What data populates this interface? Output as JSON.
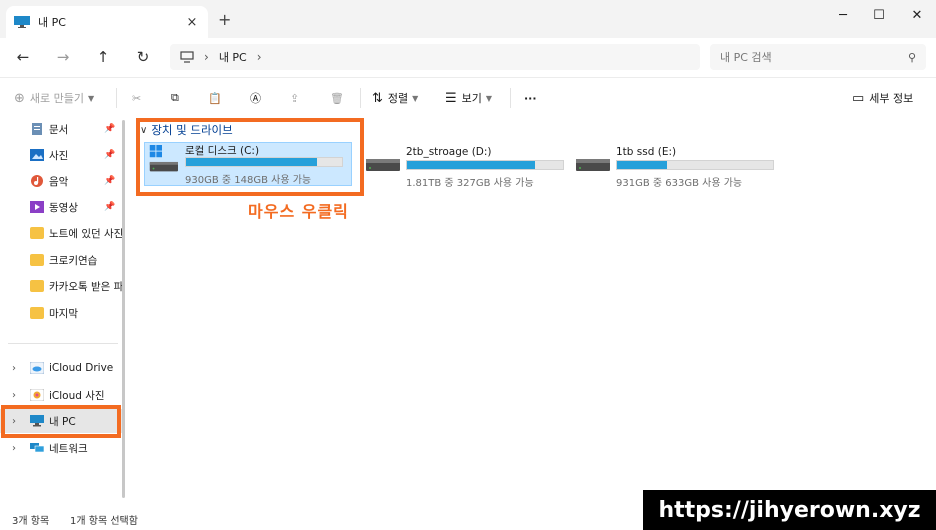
{
  "window": {
    "tab_title": "내 PC",
    "tab_close_icon": "×",
    "new_tab_icon": "+",
    "minimize_icon": "─",
    "maximize_icon": "☐",
    "close_icon": "✕"
  },
  "nav": {
    "back_icon": "←",
    "forward_icon": "→",
    "up_icon": "↑",
    "refresh_icon": "↻",
    "breadcrumb_sep": "›",
    "breadcrumb": [
      "내 PC"
    ],
    "search_placeholder": "내 PC 검색",
    "search_icon": "⚲"
  },
  "toolbar": {
    "new_label": "새로 만들기",
    "new_icon": "⊕",
    "cut_icon": "✂",
    "copy_icon": "⧉",
    "paste_icon": "📋",
    "rename_icon": "Ⓐ",
    "share_icon": "⇪",
    "delete_icon": "🗑",
    "sort_label": "정렬",
    "sort_icon": "⇅",
    "view_label": "보기",
    "view_icon": "☰",
    "more_icon": "···",
    "details_label": "세부 정보",
    "details_icon": "▭"
  },
  "sidebar": {
    "pin_icon": "📌",
    "quick": [
      {
        "label": "문서",
        "icon": "documents-icon",
        "pinned": true
      },
      {
        "label": "사진",
        "icon": "pictures-icon",
        "pinned": true
      },
      {
        "label": "음악",
        "icon": "music-icon",
        "pinned": true
      },
      {
        "label": "동영상",
        "icon": "videos-icon",
        "pinned": true
      },
      {
        "label": "노트에 있던 사진",
        "icon": "folder-icon",
        "pinned": false
      },
      {
        "label": "크로키연습",
        "icon": "folder-icon",
        "pinned": false
      },
      {
        "label": "카카오톡 받은 파일",
        "icon": "folder-icon",
        "pinned": false
      },
      {
        "label": "마지막",
        "icon": "folder-icon",
        "pinned": false
      }
    ],
    "tree": [
      {
        "label": "iCloud Drive",
        "icon": "icloud-icon"
      },
      {
        "label": "iCloud 사진",
        "icon": "icloud-photos-icon"
      },
      {
        "label": "내 PC",
        "icon": "pc-icon",
        "selected": true
      },
      {
        "label": "네트워크",
        "icon": "network-icon"
      }
    ],
    "chevron": "›"
  },
  "content": {
    "group_label": "장치 및 드라이브",
    "group_chevron": "∨",
    "drives": [
      {
        "name": "로컬 디스크 (C:)",
        "info": "930GB 중 148GB 사용 가능",
        "used_fraction": 0.84,
        "selected": true,
        "system": true
      },
      {
        "name": "2tb_stroage (D:)",
        "info": "1.81TB 중 327GB 사용 가능",
        "used_fraction": 0.82,
        "selected": false,
        "system": false
      },
      {
        "name": "1tb ssd (E:)",
        "info": "931GB 중 633GB 사용 가능",
        "used_fraction": 0.32,
        "selected": false,
        "system": false
      }
    ]
  },
  "annotation": "마우스 우클릭",
  "status": {
    "item_count": "3개 항목",
    "selected_count": "1개 항목 선택함"
  },
  "watermark": "https://jihyerown.xyz",
  "colors": {
    "accent": "#26a0da",
    "highlight": "#f36b21",
    "selection": "#cce8ff",
    "group_header": "#003e92"
  }
}
